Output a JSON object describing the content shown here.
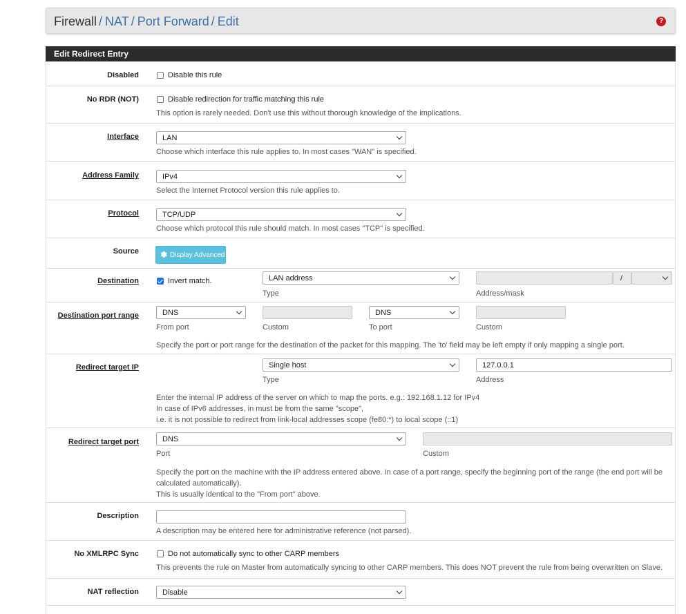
{
  "breadcrumb": {
    "root": "Firewall",
    "items": [
      "NAT",
      "Port Forward",
      "Edit"
    ],
    "separator": "/"
  },
  "help_glyph": "?",
  "panel": {
    "title": "Edit Redirect Entry"
  },
  "disabled": {
    "label": "Disabled",
    "checkbox_label": "Disable this rule",
    "checked": false
  },
  "nordr": {
    "label": "No RDR (NOT)",
    "checkbox_label": "Disable redirection for traffic matching this rule",
    "help": "This option is rarely needed. Don't use this without thorough knowledge of the implications.",
    "checked": false
  },
  "interface": {
    "label": "Interface",
    "value": "LAN",
    "help": "Choose which interface this rule applies to. In most cases \"WAN\" is specified."
  },
  "address_family": {
    "label": "Address Family",
    "value": "IPv4",
    "help": "Select the Internet Protocol version this rule applies to."
  },
  "protocol": {
    "label": "Protocol",
    "value": "TCP/UDP",
    "help": "Choose which protocol this rule should match. In most cases \"TCP\" is specified."
  },
  "source": {
    "label": "Source",
    "button_label": "Display Advanced"
  },
  "destination": {
    "label": "Destination",
    "invert_label": "Invert match.",
    "invert_checked": true,
    "type_value": "LAN address",
    "type_sub": "Type",
    "mask_sep": "/",
    "address_sub": "Address/mask"
  },
  "dest_port_range": {
    "label": "Destination port range",
    "from_value": "DNS",
    "from_sub": "From port",
    "custom_sub": "Custom",
    "to_value": "DNS",
    "to_sub": "To port",
    "custom2_sub": "Custom",
    "help": "Specify the port or port range for the destination of the packet for this mapping. The 'to' field may be left empty if only mapping a single port."
  },
  "redirect_ip": {
    "label": "Redirect target IP",
    "type_value": "Single host",
    "type_sub": "Type",
    "address_value": "127.0.0.1",
    "address_sub": "Address",
    "help1": "Enter the internal IP address of the server on which to map the ports. e.g.: 192.168.1.12 for IPv4",
    "help2": "In case of IPv6 addresses, in must be from the same \"scope\",",
    "help3": "i.e. it is not possible to redirect from link-local addresses scope (fe80:*) to local scope (::1)"
  },
  "redirect_port": {
    "label": "Redirect target port",
    "port_value": "DNS",
    "port_sub": "Port",
    "custom_sub": "Custom",
    "help1": "Specify the port on the machine with the IP address entered above. In case of a port range, specify the beginning port of the range (the end port will be",
    "help2": "calculated automatically).",
    "help3": "This is usually identical to the \"From port\" above."
  },
  "description": {
    "label": "Description",
    "value": "",
    "help": "A description may be entered here for administrative reference (not parsed)."
  },
  "xmlrpc": {
    "label": "No XMLRPC Sync",
    "checkbox_label": "Do not automatically sync to other CARP members",
    "help": "This prevents the rule on Master from automatically syncing to other CARP members. This does NOT prevent the rule from being overwritten on Slave.",
    "checked": false
  },
  "nat_reflection": {
    "label": "NAT reflection",
    "value": "Disable"
  },
  "colors": {
    "link": "#3d71a8",
    "heading_bg": "#2b2b2b",
    "button_info": "#5bc0de",
    "help_icon": "#c41a1a"
  }
}
